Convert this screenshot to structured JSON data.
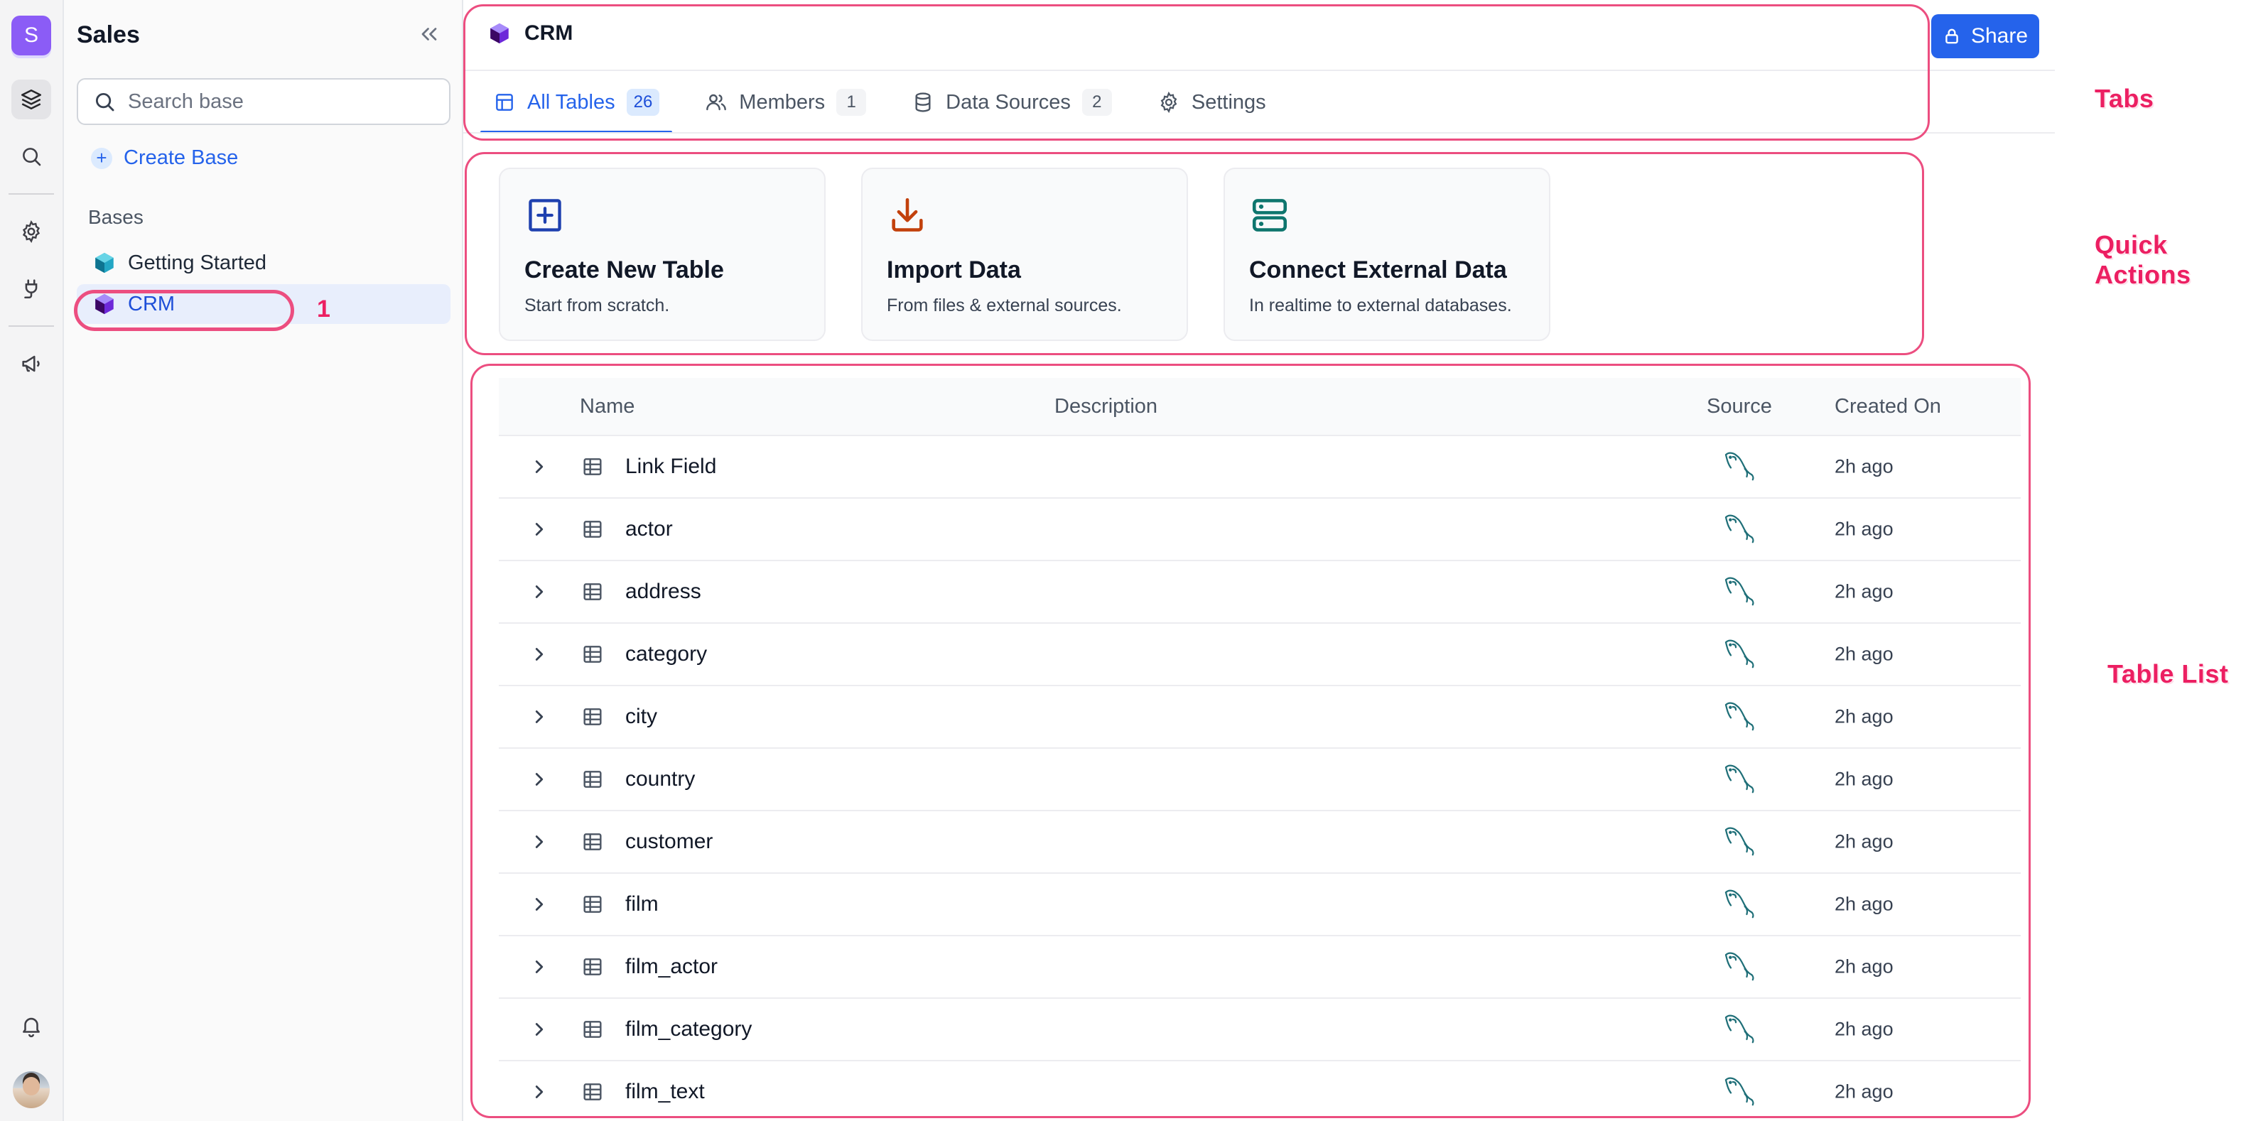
{
  "rail": {
    "workspace_initial": "S",
    "buttons": [
      "bases-icon",
      "search-icon",
      "settings-icon",
      "integrations-icon",
      "announcements-icon",
      "notifications-icon"
    ]
  },
  "sidebar": {
    "workspace_name": "Sales",
    "search_placeholder": "Search base",
    "create_base_label": "Create Base",
    "bases_section_label": "Bases",
    "bases": [
      {
        "label": "Getting Started",
        "color": "#0ea5b7"
      },
      {
        "label": "CRM",
        "color": "#7c3aed",
        "active": true
      }
    ]
  },
  "header": {
    "base_name": "CRM",
    "share_label": "Share"
  },
  "tabs": [
    {
      "label": "All Tables",
      "count": "26",
      "active": true
    },
    {
      "label": "Members",
      "count": "1"
    },
    {
      "label": "Data Sources",
      "count": "2"
    },
    {
      "label": "Settings",
      "count": ""
    }
  ],
  "quick_actions": [
    {
      "title": "Create New Table",
      "subtitle": "Start from scratch.",
      "icon": "plus-square-icon",
      "color": "#1e40af"
    },
    {
      "title": "Import Data",
      "subtitle": "From files & external sources.",
      "icon": "download-icon",
      "color": "#c2410c"
    },
    {
      "title": "Connect External Data",
      "subtitle": "In realtime to external databases.",
      "icon": "server-icon",
      "color": "#0f766e"
    }
  ],
  "table_list": {
    "columns": [
      "Name",
      "Description",
      "Source",
      "Created On"
    ],
    "rows": [
      {
        "name": "Link Field",
        "created": "2h ago"
      },
      {
        "name": "actor",
        "created": "2h ago"
      },
      {
        "name": "address",
        "created": "2h ago"
      },
      {
        "name": "category",
        "created": "2h ago"
      },
      {
        "name": "city",
        "created": "2h ago"
      },
      {
        "name": "country",
        "created": "2h ago"
      },
      {
        "name": "customer",
        "created": "2h ago"
      },
      {
        "name": "film",
        "created": "2h ago"
      },
      {
        "name": "film_actor",
        "created": "2h ago"
      },
      {
        "name": "film_category",
        "created": "2h ago"
      },
      {
        "name": "film_text",
        "created": "2h ago"
      }
    ]
  },
  "annotations": {
    "tabs_label": "Tabs",
    "quick_actions_label": "Quick Actions",
    "table_list_label": "Table List",
    "crm_marker": "1",
    "color": "#ec1f62"
  }
}
